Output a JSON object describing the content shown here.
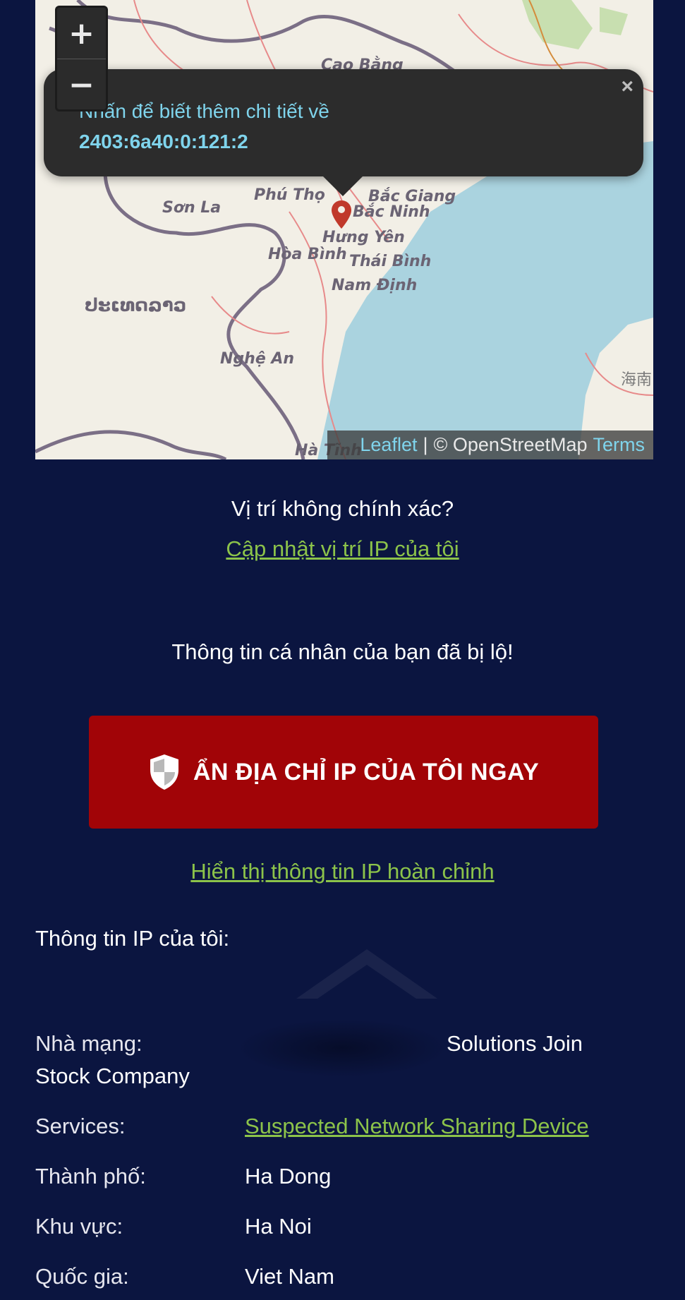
{
  "map": {
    "zoom_in": "+",
    "zoom_out": "−",
    "popup_line1": "Nhấn để biết thêm chi tiết về",
    "popup_ip": "2403:6a40:0:121:2",
    "popup_close": "×",
    "labels": {
      "cao_bang": "Cao Bằng",
      "son_la": "Sơn La",
      "phu_tho": "Phú Thọ",
      "bac_giang": "Bắc Giang",
      "bac_ninh": "Bắc Ninh",
      "hung_yen": "Hưng Yên",
      "hoa_binh": "Hòa Bình",
      "thai_binh": "Thái Bình",
      "nam_dinh": "Nam Định",
      "laos": "ປະເທດລາວ",
      "nghe_an": "Nghệ An",
      "ha_tinh": "Hà Tĩnh",
      "hainan": "海南"
    },
    "attribution": {
      "leaflet": "Leaflet",
      "sep": "|",
      "osm": "© OpenStreetMap",
      "terms": "Terms"
    }
  },
  "location_question": "Vị trí không chính xác?",
  "update_location_link": "Cập nhật vị trí IP của tôi",
  "exposed_warning": "Thông tin cá nhân của bạn đã bị lộ!",
  "hide_ip_button": "ẨN ĐỊA CHỈ IP CỦA TÔI NGAY",
  "show_full_info_link": "Hiển thị thông tin IP hoàn chỉnh",
  "info_title": "Thông tin IP của tôi:",
  "info": {
    "isp_label": "Nhà mạng:",
    "isp_value_line1": "Solutions Join",
    "isp_value_line2": "Stock Company",
    "services_label": "Services:",
    "services_value": "Suspected Network Sharing Device",
    "city_label": "Thành phố:",
    "city_value": "Ha Dong",
    "region_label": "Khu vực:",
    "region_value": "Ha Noi",
    "country_label": "Quốc gia:",
    "country_value": "Viet Nam"
  },
  "colors": {
    "background": "#0b1540",
    "cta": "#a10407",
    "link": "#8cc34a",
    "popup_accent": "#7fd4ec"
  }
}
